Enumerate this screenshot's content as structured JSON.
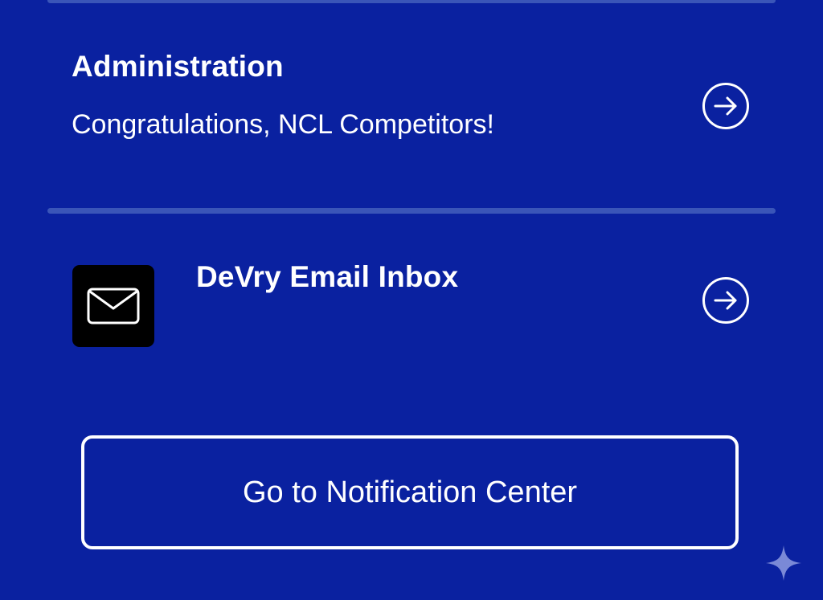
{
  "notifications": [
    {
      "title": "Administration",
      "body": "Congratulations, NCL Competitors!",
      "action_icon": "arrow-right-circle-icon"
    },
    {
      "title": "DeVry Email Inbox",
      "icon": "envelope-icon",
      "action_icon": "arrow-right-circle-icon"
    }
  ],
  "footer": {
    "button_label": "Go to Notification Center"
  },
  "colors": {
    "background": "#0a21a0",
    "divider": "#3a55b8",
    "text": "#ffffff",
    "mail_tile": "#000000"
  },
  "decorations": {
    "corner_icon": "sparkle-icon"
  }
}
